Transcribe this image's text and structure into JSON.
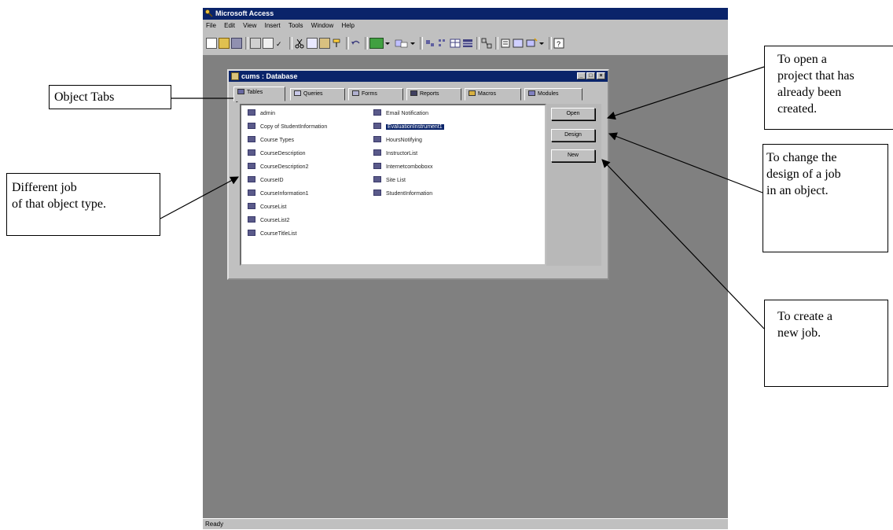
{
  "app": {
    "title": "Microsoft Access",
    "menu": [
      "File",
      "Edit",
      "View",
      "Insert",
      "Tools",
      "Window",
      "Help"
    ],
    "status": "Ready"
  },
  "db_window": {
    "title": "cums : Database",
    "tabs": [
      "Tables",
      "Queries",
      "Forms",
      "Reports",
      "Macros",
      "Modules"
    ],
    "active_tab": "Tables",
    "items_col1": [
      "admin",
      "Copy of StudentInformation",
      "Course Types",
      "CourseDescription",
      "CourseDescription2",
      "CourseID",
      "CourseInformation1",
      "CourseList",
      "CourseList2",
      "CourseTitleList"
    ],
    "items_col2": [
      "Email Notification",
      "EvaluationInstrument1",
      "HoursNotifying",
      "InstructorList",
      "Internetcomboboxx",
      "Site List",
      "StudentInformation"
    ],
    "selected_item": "EvaluationInstrument1",
    "buttons": {
      "open": "Open",
      "design": "Design",
      "new": "New"
    }
  },
  "callouts": {
    "object_tabs": "Object Tabs",
    "different_job": [
      "Different job",
      "of that object type."
    ],
    "open_project": [
      "To open a",
      "project that has",
      "already been",
      "created."
    ],
    "change_design": [
      "To change the",
      "design of a job",
      "in an object."
    ],
    "create_new": [
      "To create a",
      "new job."
    ]
  },
  "colors": {
    "titlebar": "#0a246a",
    "app_background": "#808080",
    "chrome": "#c0c0c0"
  }
}
